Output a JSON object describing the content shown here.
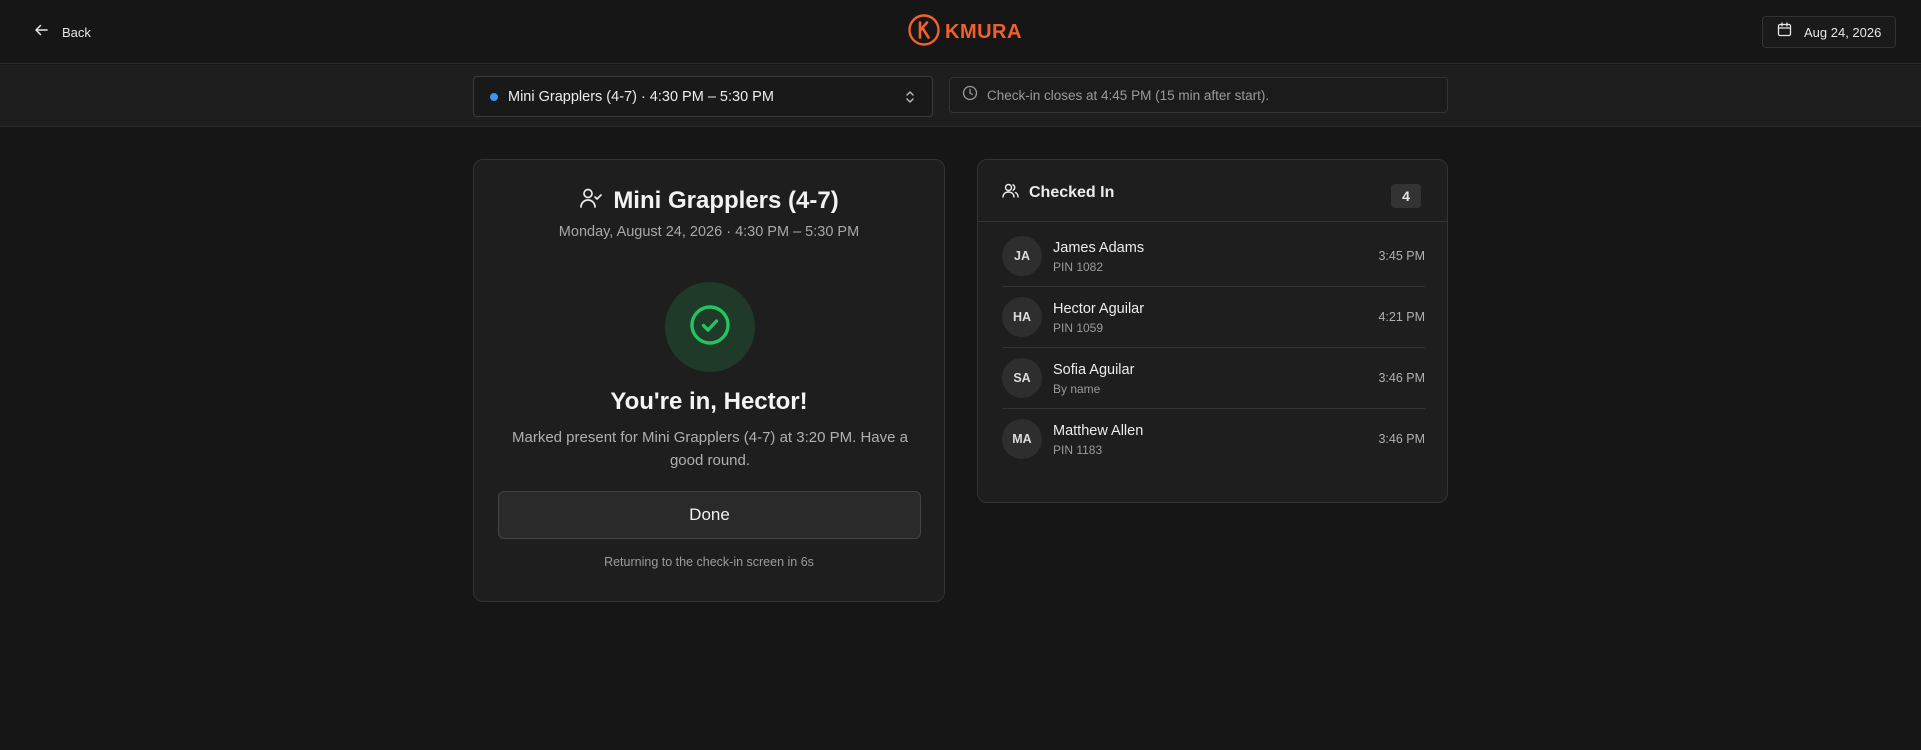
{
  "header": {
    "back_label": "Back",
    "logo_text": "KMURA",
    "date_label": "Aug 24, 2026"
  },
  "subbar": {
    "class_select_value": "Mini Grapplers (4-7) · 4:30 PM – 5:30 PM",
    "notice": "Check-in closes at 4:45 PM (15 min after start)."
  },
  "confirmation": {
    "class_title": "Mini Grapplers (4-7)",
    "class_subtitle": "Monday, August 24, 2026 · 4:30 PM – 5:30 PM",
    "heading": "You're in, Hector!",
    "message": "Marked present for Mini Grapplers (4-7) at 3:20 PM. Have a good round.",
    "done_label": "Done",
    "footer": "Returning to the check-in screen in 6s"
  },
  "checked_in": {
    "title": "Checked In",
    "count": "4",
    "attendees": [
      {
        "initials": "JA",
        "name": "James Adams",
        "detail": "PIN 1082",
        "time": "3:45 PM"
      },
      {
        "initials": "HA",
        "name": "Hector Aguilar",
        "detail": "PIN 1059",
        "time": "4:21 PM"
      },
      {
        "initials": "SA",
        "name": "Sofia Aguilar",
        "detail": "By name",
        "time": "3:46 PM"
      },
      {
        "initials": "MA",
        "name": "Matthew Allen",
        "detail": "PIN 1183",
        "time": "3:46 PM"
      }
    ]
  },
  "colors": {
    "accent": "#f0602a",
    "status_dot": "#3b94f0",
    "success": "#22c55e",
    "background": "#161616"
  },
  "icons": [
    "arrow-left-icon",
    "kmura-logo-icon",
    "calendar-icon",
    "chevron-up-down-icon",
    "clock-icon",
    "user-check-icon",
    "check-circle-icon",
    "users-icon"
  ]
}
